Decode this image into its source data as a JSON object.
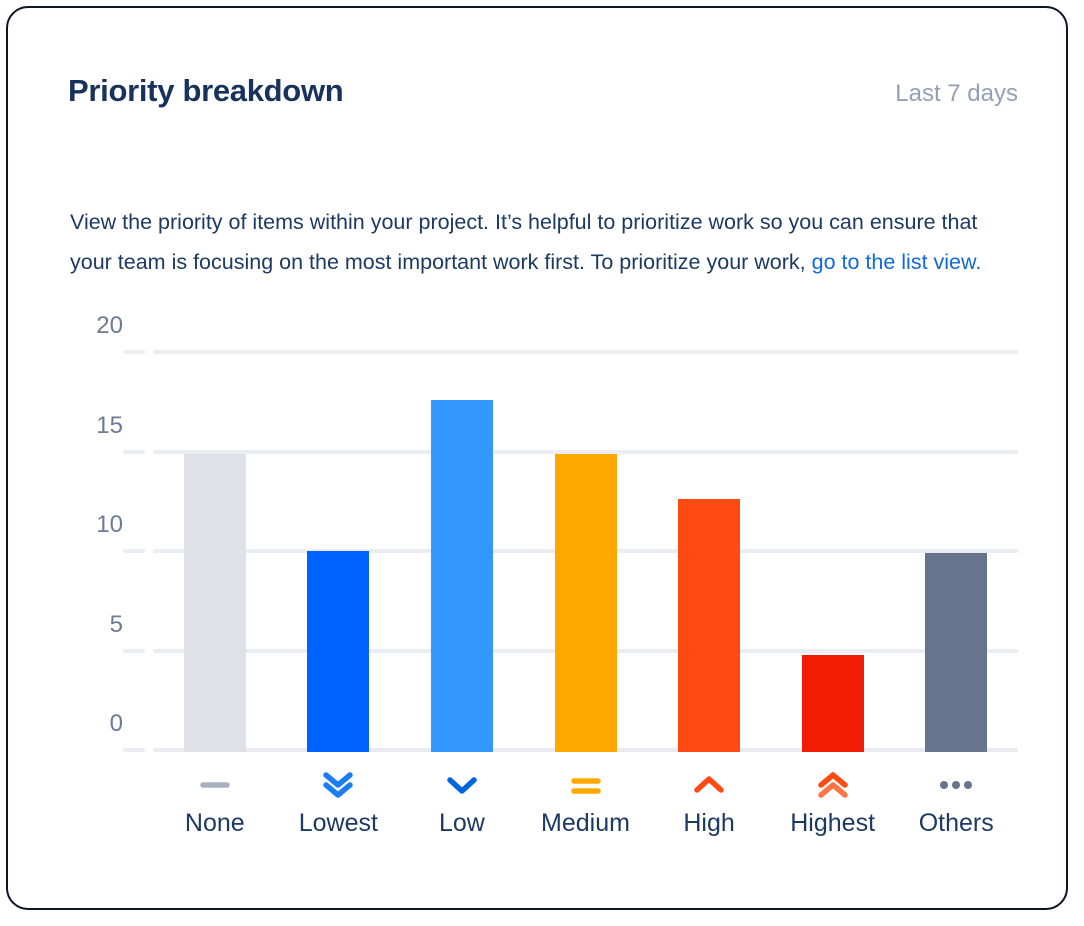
{
  "header": {
    "title": "Priority breakdown",
    "period": "Last 7 days"
  },
  "description": {
    "text_before_link": "View the priority of items within your project. It’s helpful to prioritize work so you can ensure that your team is focusing on the most important work first. To prioritize your work, ",
    "link_text": "go to the list view."
  },
  "chart_data": {
    "type": "bar",
    "title": "Priority breakdown",
    "xlabel": "",
    "ylabel": "",
    "ylim": [
      0,
      20
    ],
    "yticks": [
      0,
      5,
      10,
      15,
      20
    ],
    "ytick_labels": [
      "0",
      "5",
      "10",
      "15",
      "20"
    ],
    "grid": true,
    "legend": "none",
    "categories": [
      "None",
      "Lowest",
      "Low",
      "Medium",
      "High",
      "Highest",
      "Others"
    ],
    "values": [
      15,
      10.1,
      17.7,
      15,
      12.7,
      4.9,
      10
    ],
    "bar_colors": [
      "#dfe1e6",
      "#0062ff",
      "#3399ff",
      "#ffa800",
      "#ff4a12",
      "#f21b03",
      "#67748e"
    ],
    "icons": [
      {
        "name": "priority-none-icon",
        "glyph": "dash",
        "color": "#a7b0bf"
      },
      {
        "name": "priority-lowest-icon",
        "glyph": "double-chevron-down",
        "color": "#1b7df5"
      },
      {
        "name": "priority-low-icon",
        "glyph": "chevron-down",
        "color": "#0066e0"
      },
      {
        "name": "priority-medium-icon",
        "glyph": "equals",
        "color": "#ffa800"
      },
      {
        "name": "priority-high-icon",
        "glyph": "chevron-up",
        "color": "#ff4a12"
      },
      {
        "name": "priority-highest-icon",
        "glyph": "double-chevron-up",
        "color": "#ff4a12"
      },
      {
        "name": "priority-others-icon",
        "glyph": "ellipsis",
        "color": "#67748e"
      }
    ]
  },
  "colors": {
    "card_border": "#0b1626",
    "title": "#17325c",
    "muted": "#93a0b5",
    "body_text": "#1d3a63",
    "link": "#1068e0",
    "gridline": "#ebedf2"
  }
}
